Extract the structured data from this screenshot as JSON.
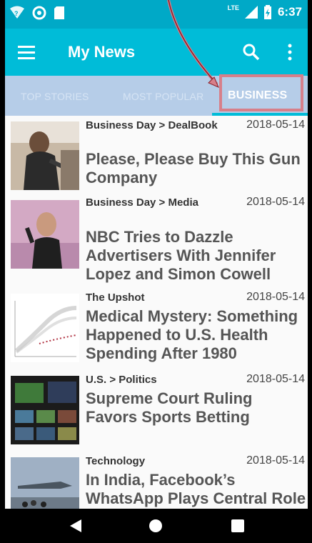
{
  "status": {
    "network": "LTE",
    "time": "6:37"
  },
  "appbar": {
    "title": "My News",
    "icons": [
      "menu-icon",
      "search-icon",
      "more-vert-icon"
    ]
  },
  "tabs": [
    {
      "label": "TOP STORIES",
      "active": false
    },
    {
      "label": "MOST POPULAR",
      "active": false
    },
    {
      "label": "BUSINESS",
      "active": true
    }
  ],
  "articles": [
    {
      "section": "Business Day > DealBook",
      "date": "2018-05-14",
      "headline": "Please, Please Buy This Gun Company"
    },
    {
      "section": "Business Day > Media",
      "date": "2018-05-14",
      "headline": "NBC Tries to Dazzle Advertisers With Jennifer Lopez and Simon Cowell"
    },
    {
      "section": "The Upshot",
      "date": "2018-05-14",
      "headline": "Medical Mystery: Something Happened to U.S. Health Spending After 1980"
    },
    {
      "section": "U.S. > Politics",
      "date": "2018-05-14",
      "headline": "Supreme Court Ruling Favors Sports Betting"
    },
    {
      "section": "Technology",
      "date": "2018-05-14",
      "headline": "In India, Facebook’s WhatsApp Plays Central Role"
    }
  ],
  "colors": {
    "statusbar": "#00a9c7",
    "appbar": "#00bcd8",
    "tabs": "#b6cde8",
    "highlight": "#d77f8a"
  }
}
